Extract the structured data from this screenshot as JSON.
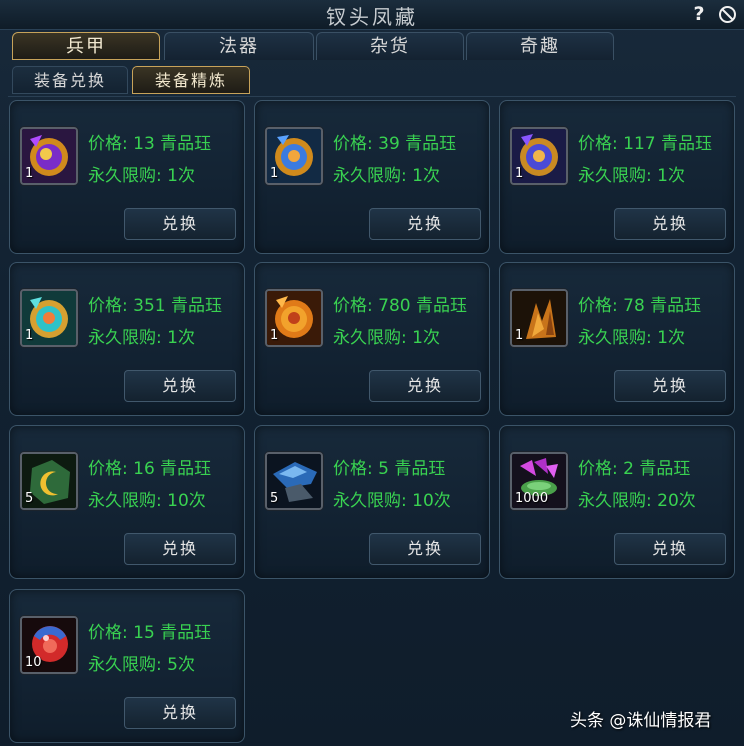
{
  "window": {
    "title": "钗头凤藏",
    "help_label": "?",
    "close_icon": "close-circle-icon"
  },
  "tabs": [
    {
      "label": "兵甲",
      "active": true
    },
    {
      "label": "法器",
      "active": false
    },
    {
      "label": "杂货",
      "active": false
    },
    {
      "label": "奇趣",
      "active": false
    }
  ],
  "subtabs": [
    {
      "label": "装备兑换",
      "active": false
    },
    {
      "label": "装备精炼",
      "active": true
    }
  ],
  "items": [
    {
      "icon": "golden-ring-purple-icon",
      "qty": "1",
      "price": "价格: 13 青品珏",
      "limit": "永久限购: 1次",
      "button": "兑换"
    },
    {
      "icon": "golden-ring-blue-icon",
      "qty": "1",
      "price": "价格: 39 青品珏",
      "limit": "永久限购: 1次",
      "button": "兑换"
    },
    {
      "icon": "golden-ring-purple-blue-icon",
      "qty": "1",
      "price": "价格: 117 青品珏",
      "limit": "永久限购: 1次",
      "button": "兑换"
    },
    {
      "icon": "golden-ring-cyan-icon",
      "qty": "1",
      "price": "价格: 351 青品珏",
      "limit": "永久限购: 1次",
      "button": "兑换"
    },
    {
      "icon": "golden-ring-orange-icon",
      "qty": "1",
      "price": "价格: 780 青品珏",
      "limit": "永久限购: 1次",
      "button": "兑换"
    },
    {
      "icon": "golden-claw-icon",
      "qty": "1",
      "price": "价格: 78 青品珏",
      "limit": "永久限购: 1次",
      "button": "兑换"
    },
    {
      "icon": "moon-stone-icon",
      "qty": "5",
      "price": "价格: 16 青品珏",
      "limit": "永久限购: 10次",
      "button": "兑换"
    },
    {
      "icon": "blue-crystal-icon",
      "qty": "5",
      "price": "价格: 5 青品珏",
      "limit": "永久限购: 10次",
      "button": "兑换"
    },
    {
      "icon": "purple-gem-icon",
      "qty": "1000",
      "price": "价格: 2 青品珏",
      "limit": "永久限购: 20次",
      "button": "兑换"
    },
    {
      "icon": "red-orb-icon",
      "qty": "10",
      "price": "价格: 15 青品珏",
      "limit": "永久限购: 5次",
      "button": "兑换"
    }
  ],
  "watermark": "头条 @诛仙情报君",
  "colors": {
    "price_text": "#39d251",
    "active_tab_border": "#c7a35a",
    "panel_bg": "#132333"
  }
}
